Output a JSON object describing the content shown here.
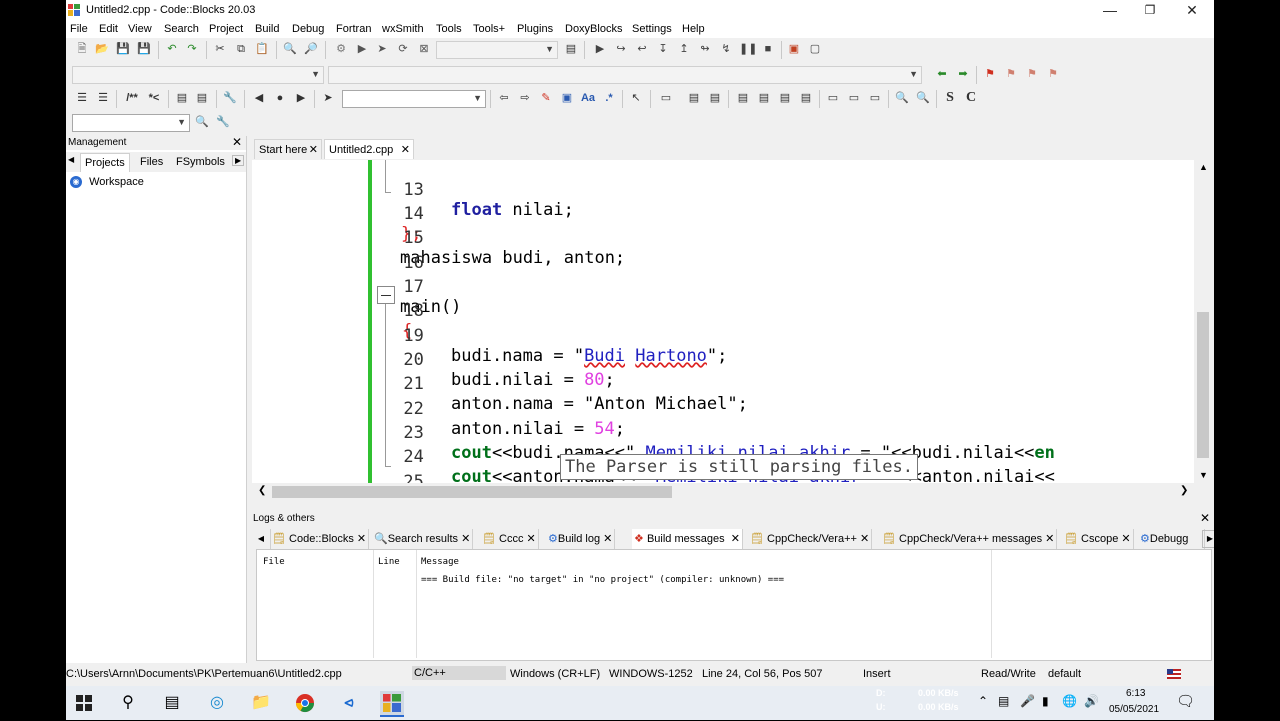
{
  "window": {
    "title": "Untitled2.cpp - Code::Blocks 20.03"
  },
  "menu": [
    "File",
    "Edit",
    "View",
    "Search",
    "Project",
    "Build",
    "Debug",
    "Fortran",
    "wxSmith",
    "Tools",
    "Tools+",
    "Plugins",
    "DoxyBlocks",
    "Settings",
    "Help"
  ],
  "management": {
    "title": "Management",
    "tabs": [
      "Projects",
      "Files",
      "FSymbols"
    ],
    "tree_root": "Workspace"
  },
  "editor": {
    "tabs": [
      "Start here",
      "Untitled2.cpp"
    ],
    "lines": [
      {
        "n": "13"
      },
      {
        "n": "14"
      },
      {
        "n": "15"
      },
      {
        "n": "16"
      },
      {
        "n": "17"
      },
      {
        "n": "18"
      },
      {
        "n": "19"
      },
      {
        "n": "20"
      },
      {
        "n": "21"
      },
      {
        "n": "22"
      },
      {
        "n": "23"
      },
      {
        "n": "24"
      },
      {
        "n": "25"
      }
    ],
    "code": {
      "l13_kw": "float",
      "l13_rest": " nilai;",
      "l14": "};",
      "l15": "mahasiswa budi, anton;",
      "l17": "main()",
      "l18": "{",
      "l19_a": "budi.nama = \"",
      "l19_b": "Budi",
      "l19_c": " ",
      "l19_d": "Hartono",
      "l19_e": "\";",
      "l20_a": "budi.nilai = ",
      "l20_b": "80",
      "l20_c": ";",
      "l21_a": "anton.nama = \"Anton Michael\";",
      "l22_a": "anton.nilai = ",
      "l22_b": "54",
      "l22_c": ";",
      "l23_kw": "cout",
      "l23_a": "<<budi.nama<<\" ",
      "l23_b": "Memiliki nilai akhir",
      "l23_c": " = \"<<budi.nilai<<",
      "l23_d": "en",
      "l24_kw": "cout",
      "l24_a": "<<anton.nama<<\" ",
      "l24_b": "Memiliki nilai akhir",
      "l24_c": " = \"<<anton.nilai<<",
      "l25": "}"
    },
    "tooltip": "The Parser is still parsing files."
  },
  "logs": {
    "title": "Logs & others",
    "tabs": [
      "Code::Blocks",
      "Search results",
      "Cccc",
      "Build log",
      "Build messages",
      "CppCheck/Vera++",
      "CppCheck/Vera++ messages",
      "Cscope",
      "Debugg"
    ],
    "columns": [
      "File",
      "Line",
      "Message"
    ],
    "message": "=== Build file: \"no target\" in \"no project\" (compiler: unknown) ==="
  },
  "status": {
    "path": "C:\\Users\\Arnn\\Documents\\PK\\Pertemuan6\\Untitled2.cpp",
    "lang": "C/C++",
    "eol": "Windows (CR+LF)",
    "encoding": "WINDOWS-1252",
    "pos": "Line 24, Col 56, Pos 507",
    "mode": "Insert",
    "rw": "Read/Write",
    "theme": "default"
  },
  "taskbar": {
    "drive_d": "D:",
    "drive_u": "U:",
    "speed1": "0.00 KB/s",
    "speed2": "0.00 KB/s",
    "time": "6:13",
    "date": "05/05/2021"
  }
}
